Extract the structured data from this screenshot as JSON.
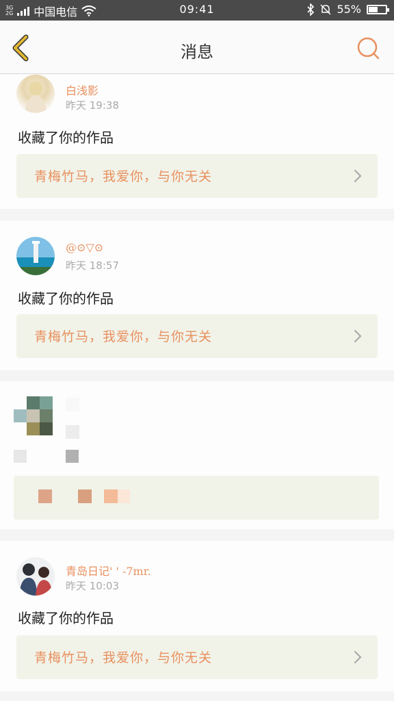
{
  "status_bar": {
    "network_tag": "3G\n2G",
    "carrier": "中国电信",
    "time": "09:41",
    "battery_text": "55%",
    "battery_level": 0.55,
    "icons": [
      "signal-icon",
      "wifi-icon",
      "bluetooth-icon",
      "mute-icon",
      "battery-icon"
    ]
  },
  "header": {
    "title": "消息",
    "back_icon": "chevron-left-icon",
    "search_icon": "search-icon"
  },
  "colors": {
    "accent": "#e8905e",
    "back_arrow": "#e2b833",
    "work_box_bg": "#f1f3e9"
  },
  "messages": [
    {
      "name": "白浅影",
      "time": "昨天 19:38",
      "action": "收藏了你的作品",
      "work_title": "青梅竹马，我爱你，与你无关"
    },
    {
      "name": "@⊙▽⊙",
      "time": "昨天 18:57",
      "action": "收藏了你的作品",
      "work_title": "青梅竹马，我爱你，与你无关"
    },
    {
      "name": "",
      "time": "",
      "action": "",
      "work_title": ""
    },
    {
      "name": "青岛日记'  '  -7mr.",
      "time": "昨天 10:03",
      "action": "收藏了你的作品",
      "work_title": "青梅竹马，我爱你，与你无关"
    }
  ]
}
